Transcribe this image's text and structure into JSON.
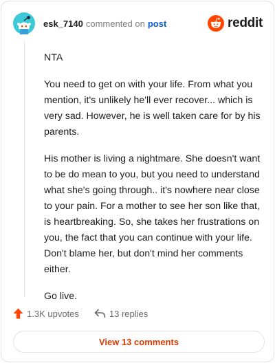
{
  "comment": {
    "username": "esk_7140",
    "action_text": "commented on",
    "post_link": "post",
    "paragraphs": [
      "NTA",
      "You need to get on with your life. From what you mention, it's unlikely he'll ever recover... which is very sad. However, he is well taken care for by his parents.",
      "His mother is living a nightmare. She doesn't want to be do mean to you, but you need to understand what she's going through.. it's nowhere near close to your pain. For a mother to see her son like that, is heartbreaking. So, she takes her frustrations on you, the fact that you can continue with your life. Don't blame her, but don't mind her comments either.",
      "Go live."
    ]
  },
  "brand": {
    "name": "reddit",
    "icon": "reddit-logo-icon",
    "color": "#ff4500"
  },
  "actions": {
    "upvotes": "1.3K upvotes",
    "replies": "13 replies",
    "upvote_icon": "upvote-arrow-icon",
    "reply_icon": "reply-arrow-icon",
    "upvote_color": "#ff4500"
  },
  "footer": {
    "view_label": "View 13 comments",
    "accent": "#d93a00"
  }
}
